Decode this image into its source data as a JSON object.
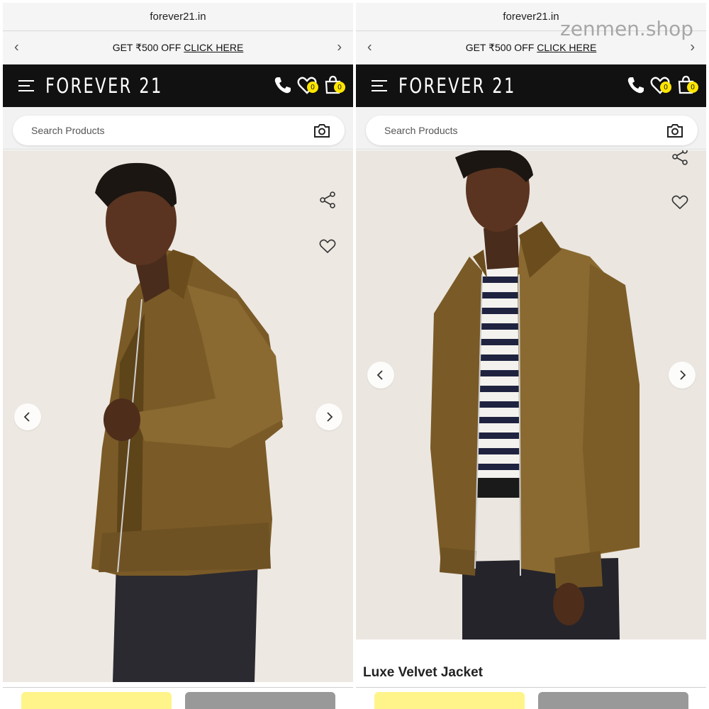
{
  "watermark": "zenmen.shop",
  "colors": {
    "header_bg": "#111111",
    "badge": "#ffe600",
    "cta_primary": "#fff48a",
    "cta_secondary": "#999999"
  },
  "screens": [
    {
      "url": "forever21.in",
      "promo": {
        "text": "GET ₹500 OFF",
        "link": "CLICK HERE"
      },
      "brand": "FOREVER 21",
      "wishlist_count": "0",
      "cart_count": "0",
      "search_placeholder": "Search Products",
      "icons": [
        "menu-icon",
        "phone-icon",
        "wishlist-icon",
        "cart-icon",
        "camera-icon",
        "share-icon",
        "heart-icon",
        "chevron-left-icon",
        "chevron-right-icon"
      ]
    },
    {
      "url": "forever21.in",
      "promo": {
        "text": "GET ₹500 OFF",
        "link": "CLICK HERE"
      },
      "brand": "FOREVER 21",
      "wishlist_count": "0",
      "cart_count": "0",
      "search_placeholder": "Search Products",
      "product_name": "Luxe Velvet Jacket"
    }
  ]
}
